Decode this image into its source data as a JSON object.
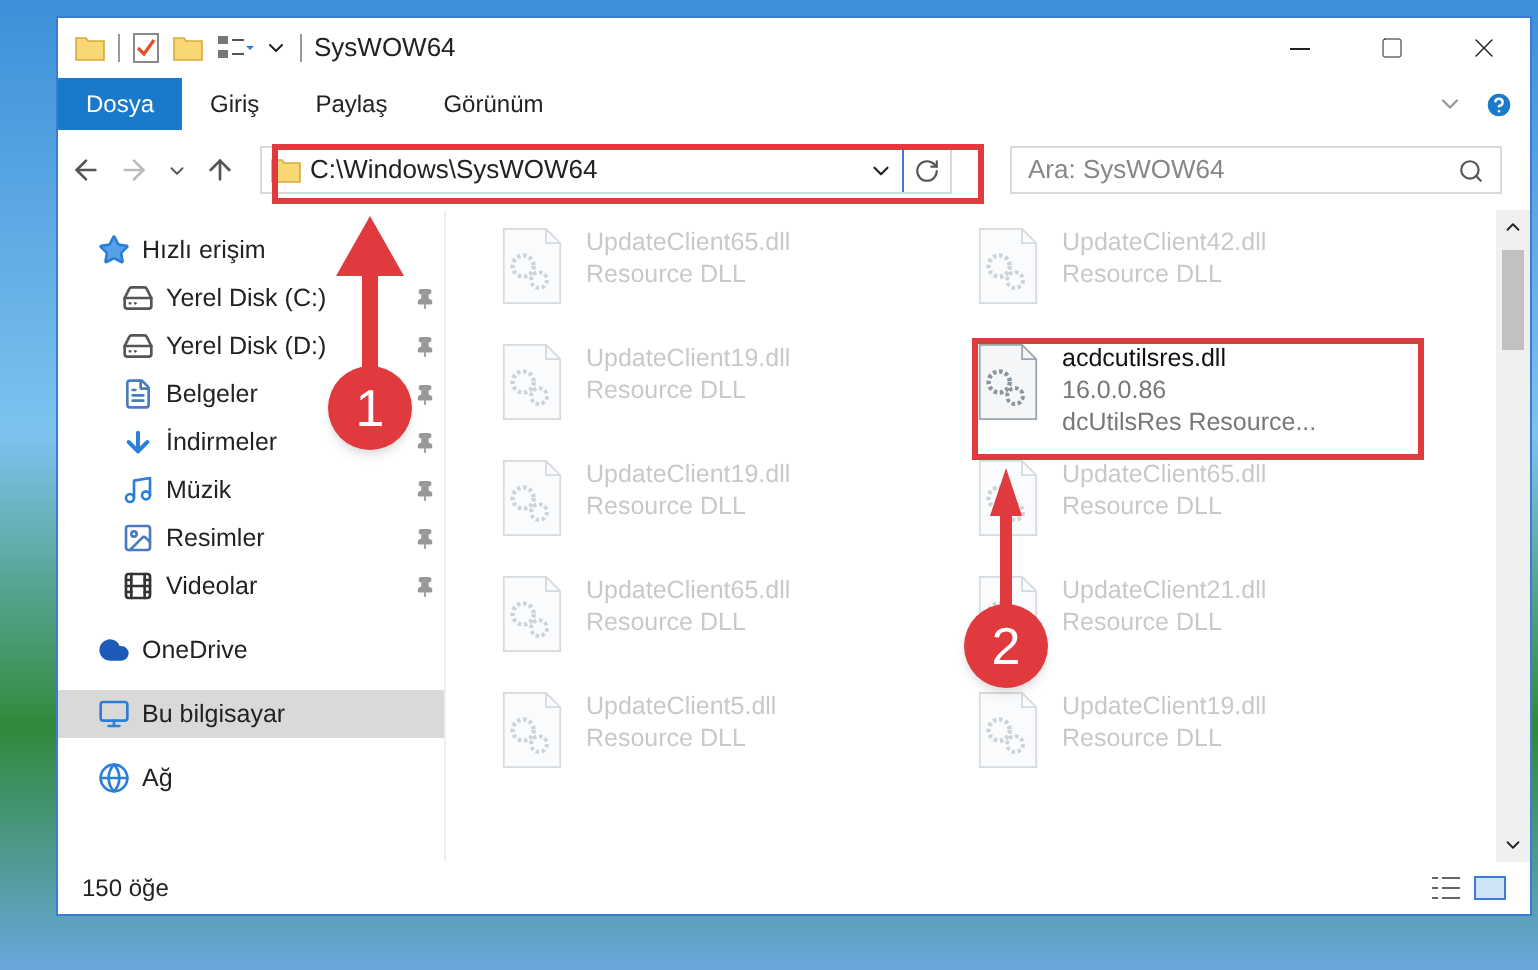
{
  "window": {
    "title": "SysWOW64"
  },
  "ribbon_tabs": [
    {
      "label": "Dosya",
      "selected": true
    },
    {
      "label": "Giriş",
      "selected": false
    },
    {
      "label": "Paylaş",
      "selected": false
    },
    {
      "label": "Görünüm",
      "selected": false
    }
  ],
  "address": {
    "path": "C:\\Windows\\SysWOW64"
  },
  "search": {
    "placeholder": "Ara: SysWOW64"
  },
  "sidebar": {
    "items": [
      {
        "label": "Hızlı erişim",
        "selected": false,
        "children": [
          {
            "label": "Yerel Disk (C:)",
            "pinned": true
          },
          {
            "label": "Yerel Disk (D:)",
            "pinned": true
          },
          {
            "label": "Belgeler",
            "pinned": true
          },
          {
            "label": "İndirmeler",
            "pinned": true
          },
          {
            "label": "Müzik",
            "pinned": true
          },
          {
            "label": "Resimler",
            "pinned": true
          },
          {
            "label": "Videolar",
            "pinned": true
          }
        ]
      },
      {
        "label": "OneDrive",
        "selected": false
      },
      {
        "label": "Bu bilgisayar",
        "selected": true
      },
      {
        "label": "Ağ",
        "selected": false
      }
    ]
  },
  "files": [
    {
      "name": "UpdateClient65.dll",
      "details": [
        "Resource DLL"
      ],
      "faded": true
    },
    {
      "name": "UpdateClient42.dll",
      "details": [
        "Resource DLL"
      ],
      "faded": true
    },
    {
      "name": "UpdateClient19.dll",
      "details": [
        "Resource DLL"
      ],
      "faded": true
    },
    {
      "name": "acdcutilsres.dll",
      "details": [
        "16.0.0.86",
        "dcUtilsRes Resource..."
      ],
      "faded": false
    },
    {
      "name": "UpdateClient19.dll",
      "details": [
        "Resource DLL"
      ],
      "faded": true
    },
    {
      "name": "UpdateClient65.dll",
      "details": [
        "Resource DLL"
      ],
      "faded": true
    },
    {
      "name": "UpdateClient65.dll",
      "details": [
        "Resource DLL"
      ],
      "faded": true
    },
    {
      "name": "UpdateClient21.dll",
      "details": [
        "Resource DLL"
      ],
      "faded": true
    },
    {
      "name": "UpdateClient5.dll",
      "details": [
        "Resource DLL"
      ],
      "faded": true
    },
    {
      "name": "UpdateClient19.dll",
      "details": [
        "Resource DLL"
      ],
      "faded": true
    }
  ],
  "status_bar": {
    "item_count": "150 öğe"
  },
  "annotations": [
    {
      "label": "1"
    },
    {
      "label": "2"
    }
  ]
}
